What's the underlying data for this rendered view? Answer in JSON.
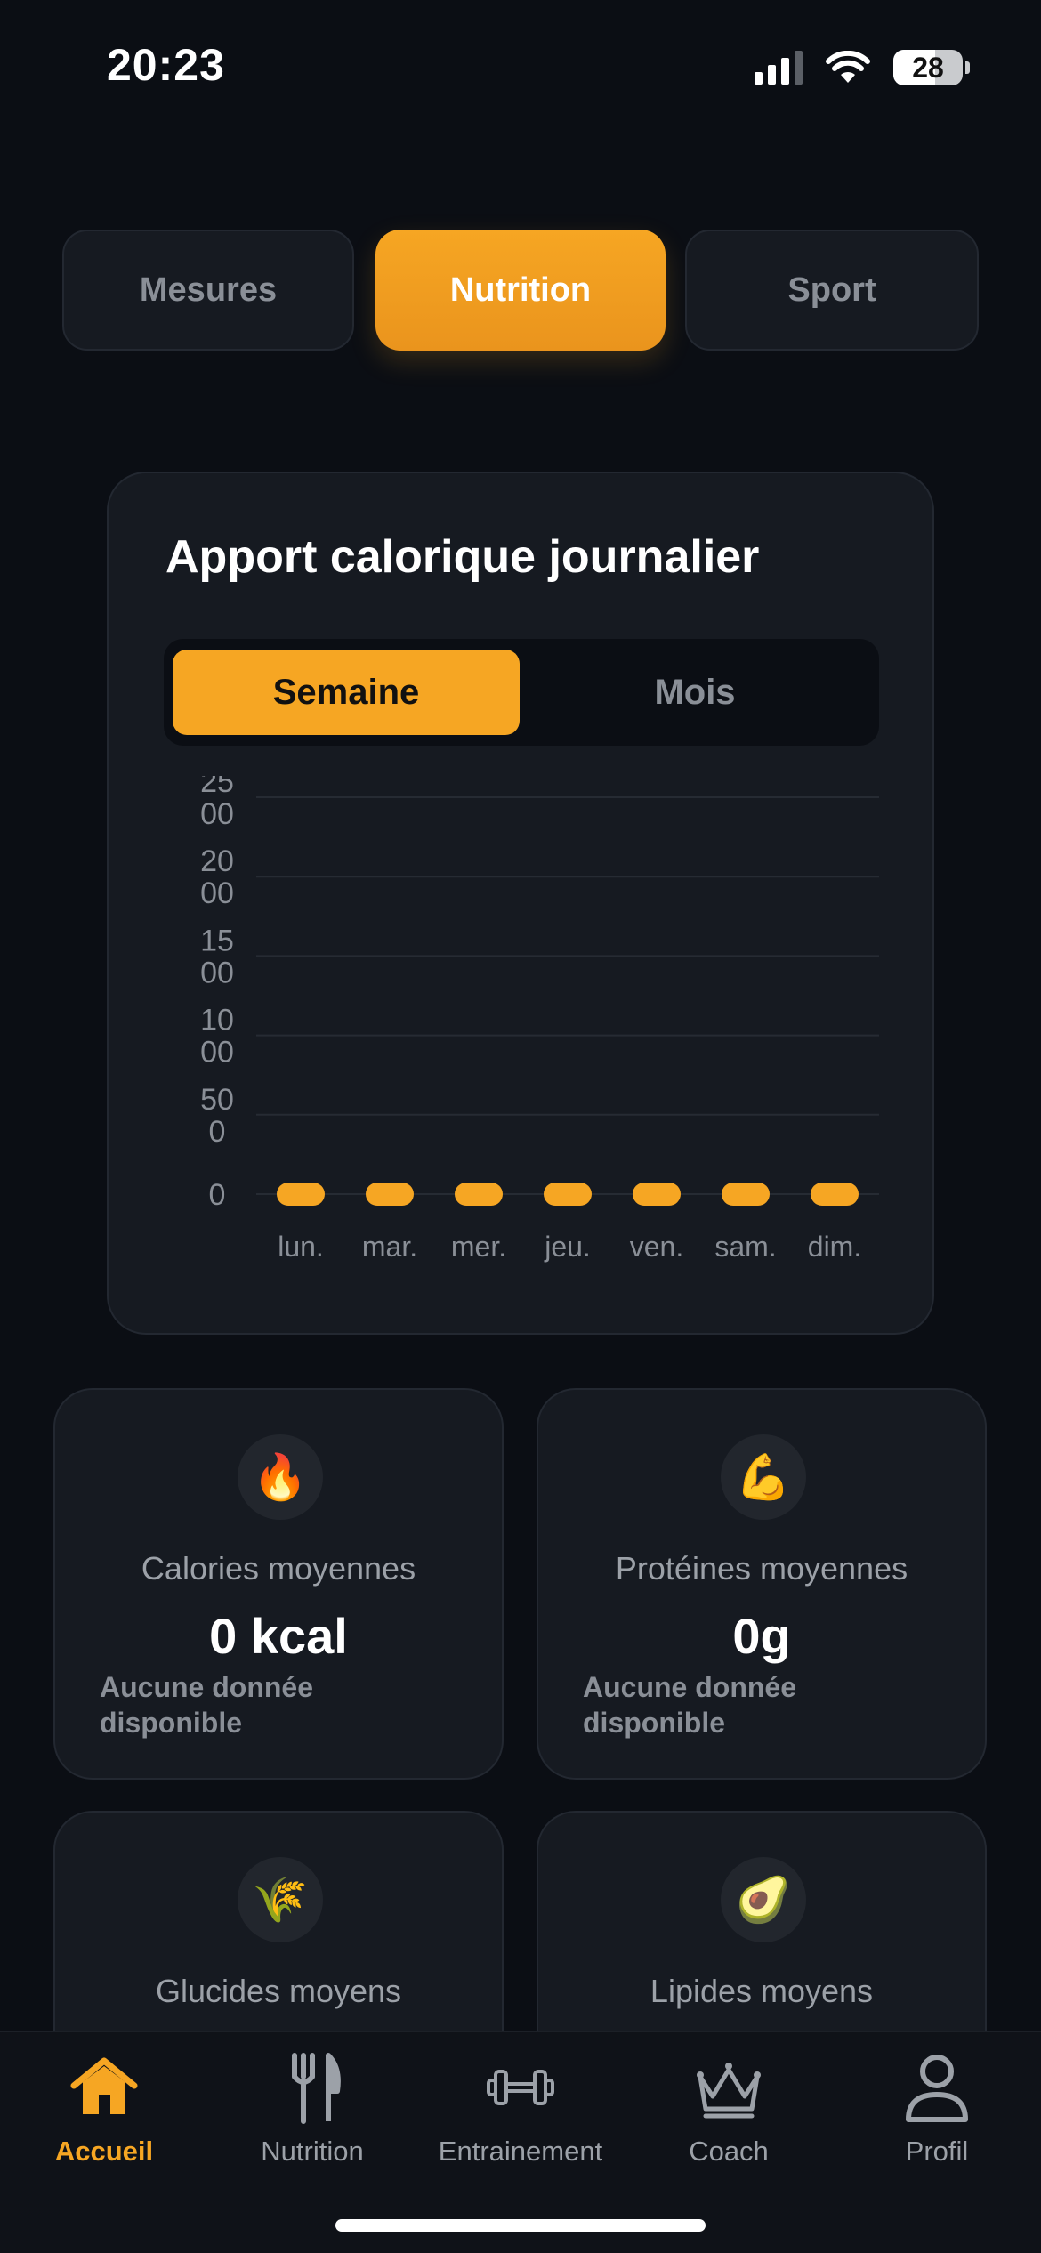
{
  "status_bar": {
    "time": "20:23",
    "battery": "28"
  },
  "top_tabs": [
    {
      "label": "Mesures",
      "active": false
    },
    {
      "label": "Nutrition",
      "active": true
    },
    {
      "label": "Sport",
      "active": false
    }
  ],
  "chart_card": {
    "title": "Apport calorique journalier",
    "range_toggle": {
      "selected": "Semaine",
      "other": "Mois"
    }
  },
  "chart_data": {
    "type": "bar",
    "categories": [
      "lun.",
      "mar.",
      "mer.",
      "jeu.",
      "ven.",
      "sam.",
      "dim."
    ],
    "values": [
      0,
      0,
      0,
      0,
      0,
      0,
      0
    ],
    "ylim": [
      0,
      2500
    ],
    "y_ticks": [
      {
        "value": 2500,
        "lines": [
          "25",
          "00"
        ]
      },
      {
        "value": 2000,
        "lines": [
          "20",
          "00"
        ]
      },
      {
        "value": 1500,
        "lines": [
          "15",
          "00"
        ]
      },
      {
        "value": 1000,
        "lines": [
          "10",
          "00"
        ]
      },
      {
        "value": 500,
        "lines": [
          "50",
          "0"
        ]
      },
      {
        "value": 0,
        "lines": [
          "0"
        ]
      }
    ],
    "grid": true,
    "bar_color": "#f6a623",
    "title": "",
    "xlabel": "",
    "ylabel": ""
  },
  "stats": [
    {
      "icon": "🔥",
      "icon_name": "fire-icon",
      "label": "Calories moyennes",
      "value": "0 kcal",
      "note": "Aucune donnée disponible"
    },
    {
      "icon": "💪",
      "icon_name": "flexed-biceps-icon",
      "label": "Protéines moyennes",
      "value": "0g",
      "note": "Aucune donnée disponible"
    },
    {
      "icon": "🌾",
      "icon_name": "rice-icon",
      "label": "Glucides moyens",
      "value": "",
      "note": ""
    },
    {
      "icon": "🥑",
      "icon_name": "avocado-icon",
      "label": "Lipides moyens",
      "value": "",
      "note": ""
    }
  ],
  "bottom_nav": [
    {
      "label": "Accueil",
      "icon": "home-icon",
      "active": true
    },
    {
      "label": "Nutrition",
      "icon": "fork-knife-icon",
      "active": false
    },
    {
      "label": "Entrainement",
      "icon": "dumbbell-icon",
      "active": false
    },
    {
      "label": "Coach",
      "icon": "crown-icon",
      "active": false
    },
    {
      "label": "Profil",
      "icon": "person-icon",
      "active": false
    }
  ],
  "colors": {
    "accent": "#f6a623",
    "background": "#0b0e14",
    "card": "#161a21"
  }
}
